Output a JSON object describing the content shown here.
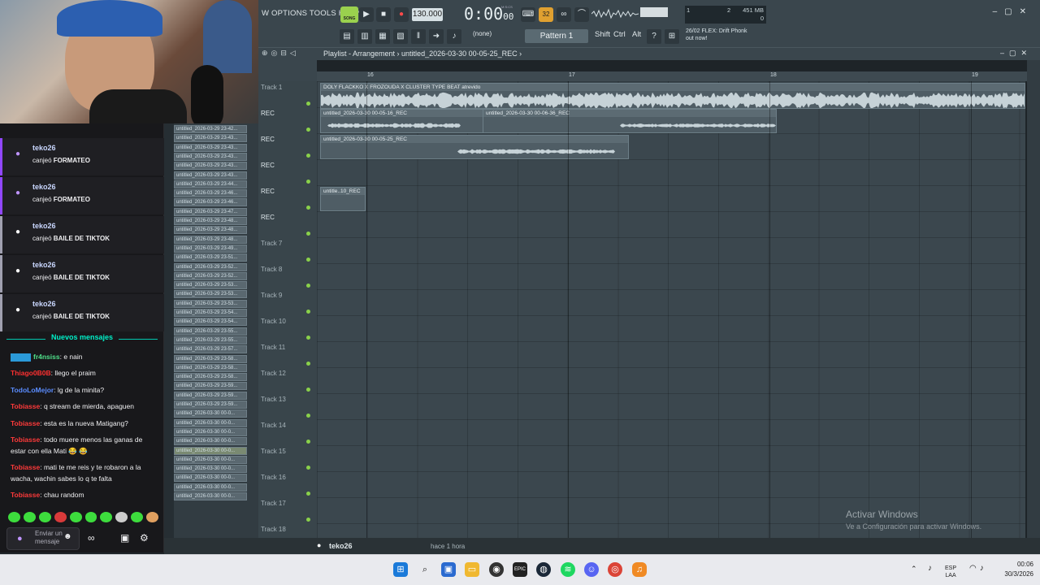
{
  "chat": {
    "redeems": [
      {
        "user": "teko26",
        "prefix": "canjeó ",
        "reward": "FORMATEO"
      },
      {
        "user": "teko26",
        "prefix": "canjeó ",
        "reward": "FORMATEO"
      },
      {
        "user": "teko26",
        "prefix": "canjeó ",
        "reward": "BAILE DE TIKTOK"
      },
      {
        "user": "teko26",
        "prefix": "canjeó ",
        "reward": "BAILE DE TIKTOK"
      },
      {
        "user": "teko26",
        "prefix": "canjeó ",
        "reward": "BAILE DE TIKTOK"
      }
    ],
    "new_messages": "Nuevos mensajes",
    "messages": [
      {
        "name": "fr4nsiss",
        "color": "#4fe08a",
        "text": ": e nain"
      },
      {
        "name": "Thiago0B0B",
        "color": "#ff3030",
        "text": ": llego el praim"
      },
      {
        "name": "TodoLoMejor",
        "color": "#5a8cff",
        "text": ": lg de la minita?"
      },
      {
        "name": "Tobiasse",
        "color": "#ff3a3a",
        "text": ": q stream de mierda, apaguen"
      },
      {
        "name": "Tobiasse",
        "color": "#ff3a3a",
        "text": ": esta es la nueva Matigang?"
      },
      {
        "name": "Tobiasse",
        "color": "#ff3a3a",
        "text": ": todo muere menos las ganas de estar con ella Mati 😂 😂"
      },
      {
        "name": "Tobiasse",
        "color": "#ff3a3a",
        "text": ": mati te me reis y te robaron a la wacha, wachin sabes lo q te falta"
      },
      {
        "name": "Tobiasse",
        "color": "#ff3a3a",
        "text": ": chau random"
      }
    ],
    "input_placeholder": "Enviar un mensaje"
  },
  "browser": {
    "files": [
      "untitled_2026-03-29 23-42...",
      "untitled_2026-03-29 23-43...",
      "untitled_2026-03-29 23-43...",
      "untitled_2026-03-29 23-43...",
      "untitled_2026-03-29 23-43...",
      "untitled_2026-03-29 23-43...",
      "untitled_2026-03-29 23-44...",
      "untitled_2026-03-29 23-46...",
      "untitled_2026-03-29 23-46...",
      "untitled_2026-03-29 23-47...",
      "untitled_2026-03-29 23-48...",
      "untitled_2026-03-29 23-48...",
      "untitled_2026-03-29 23-48...",
      "untitled_2026-03-29 23-49...",
      "untitled_2026-03-29 23-51...",
      "untitled_2026-03-29 23-52...",
      "untitled_2026-03-29 23-52...",
      "untitled_2026-03-29 23-53...",
      "untitled_2026-03-29 23-53...",
      "untitled_2026-03-29 23-53...",
      "untitled_2026-03-29 23-54...",
      "untitled_2026-03-29 23-54...",
      "untitled_2026-03-29 23-55...",
      "untitled_2026-03-29 23-55...",
      "untitled_2026-03-29 23-57...",
      "untitled_2026-03-29 23-58...",
      "untitled_2026-03-29 23-58...",
      "untitled_2026-03-29 23-58...",
      "untitled_2026-03-29 23-59...",
      "untitled_2026-03-29 23-59...",
      "untitled_2026-03-29 23-59...",
      "untitled_2026-03-30 00-0...",
      "untitled_2026-03-30 00-0...",
      "untitled_2026-03-30 00-0...",
      "untitled_2026-03-30 00-0...",
      "untitled_2026-03-30 00-0...",
      "untitled_2026-03-30 00-0...",
      "untitled_2026-03-30 00-0...",
      "untitled_2026-03-30 00-0...",
      "untitled_2026-03-30 00-0...",
      "untitled_2026-03-30 00-0..."
    ],
    "selected_index": 35
  },
  "fl": {
    "menu": "W OPTIONS TOOLS HELP",
    "song_mode": "SONG",
    "tempo": "130.000",
    "time": "0:00",
    "time_small": "00",
    "time_unit": "M:S:CS",
    "cpu_top_left": "1",
    "cpu_top_mid": "2",
    "memory": "451 MB",
    "cpu_bottom": "0",
    "pattern_none": "(none)",
    "pattern": "Pattern 1",
    "keys": [
      "Shift",
      "Ctrl",
      "Alt"
    ],
    "news_date": "26/02",
    "news_text": "FLEX: Drift Phonk",
    "news_text2": "out now!"
  },
  "playlist": {
    "title": "Playlist - Arrangement",
    "path": "untitled_2026-03-30 00-05-25_REC",
    "ruler": [
      "16",
      "17",
      "18",
      "19"
    ],
    "tracks": [
      "Track 1",
      "REC",
      "REC",
      "REC",
      "REC",
      "REC",
      "Track 7",
      "Track 8",
      "Track 9",
      "Track 10",
      "Track 11",
      "Track 12",
      "Track 13",
      "Track 14",
      "Track 15",
      "Track 16",
      "Track 17",
      "Track 18"
    ],
    "clips": [
      {
        "label": "DOLY FLACKKO X FROZOUDA X CLUSTER TYPE BEAT atrevido"
      },
      {
        "label": "untitled_2026-03-30 00-05-16_REC"
      },
      {
        "label": "untitled_2026-03-30 00-06-36_REC"
      },
      {
        "label": "untitled_2026-03-30 00-05-25_REC"
      },
      {
        "label": "untitle..10_REC"
      }
    ]
  },
  "bottom": {
    "user": "teko26",
    "ago": "hace 1 hora"
  },
  "watermark": {
    "line1": "Activar Windows",
    "line2": "Ve a Configuración para activar Windows."
  },
  "taskbar": {
    "lang1": "ESP",
    "lang2": "LAA",
    "time": "00:06",
    "date": "30/3/2026"
  }
}
